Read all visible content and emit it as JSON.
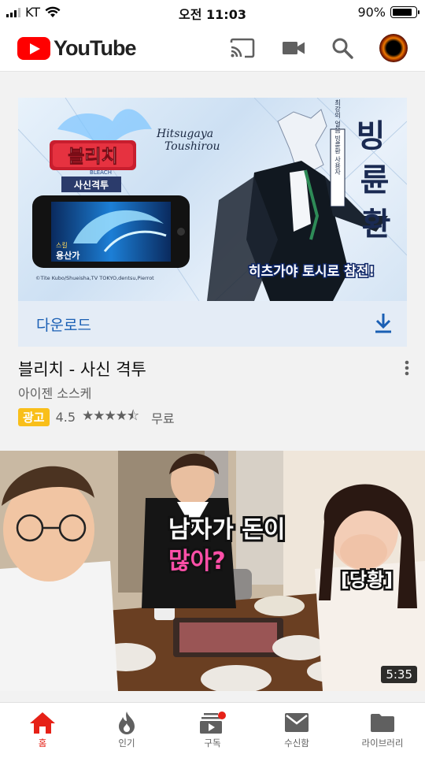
{
  "status": {
    "carrier": "KT",
    "time": "오전 11:03",
    "battery": "90%",
    "battery_level": 0.9
  },
  "app": {
    "logo_text": "YouTube"
  },
  "topbar_icons": [
    "cast-icon",
    "camera-icon",
    "search-icon",
    "avatar"
  ],
  "ad": {
    "banner": {
      "game_logo_main": "블리치",
      "game_logo_sub": "BLEACH",
      "game_logo_tag": "사신격투",
      "character_en": "Hitsugaya Toushirou",
      "character_kr": "빙륜환",
      "vertical_text": "최강의 얼음 빙륜환 사용자",
      "phone_caption_small": "스킬",
      "phone_caption": "용산가",
      "slogan": "히츠가야 토시로 참전!",
      "copyright": "©Tite Kubo/Shueisha,TV TOKYO,dentsu,Pierrot"
    },
    "download_label": "다운로드",
    "title": "블리치 - 사신 격투",
    "developer": "아이젠 소스케",
    "badge": "광고",
    "rating": "4.5",
    "rating_value": 4.5,
    "price": "무료"
  },
  "video": {
    "caption_line1": "남자가 돈이",
    "caption_line2": "많아?",
    "reaction": "[당황]",
    "duration": "5:35"
  },
  "bottom_nav": [
    {
      "label": "홈",
      "icon": "home-icon",
      "active": true
    },
    {
      "label": "인기",
      "icon": "flame-icon",
      "active": false
    },
    {
      "label": "구독",
      "icon": "subscriptions-icon",
      "active": false
    },
    {
      "label": "수신함",
      "icon": "inbox-icon",
      "active": false
    },
    {
      "label": "라이브러리",
      "icon": "library-icon",
      "active": false
    }
  ],
  "colors": {
    "brand_red": "#ff0000",
    "accent_blue": "#1a5fb4",
    "ad_badge": "#f9bf1a",
    "active_tab": "#e62117"
  }
}
